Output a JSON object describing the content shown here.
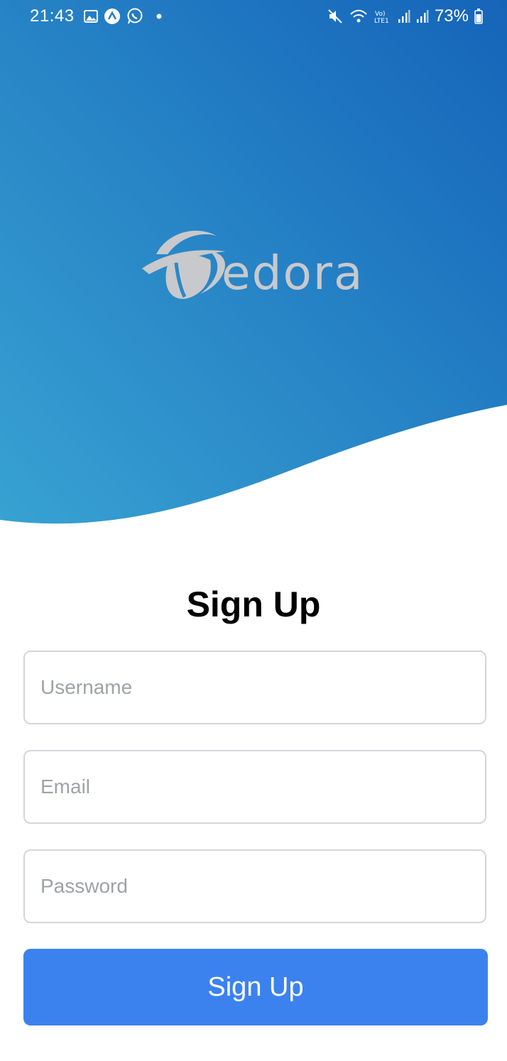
{
  "status_bar": {
    "time": "21:43",
    "battery": "73%",
    "left_icons": [
      "gallery-icon",
      "app-icon",
      "whatsapp-icon",
      "dot-icon"
    ],
    "right_icons": [
      "mute-icon",
      "wifi-icon",
      "volte-icon",
      "signal-icon",
      "signal-icon",
      "battery-icon"
    ]
  },
  "hero": {
    "logo_text": "edora",
    "gradient_colors": [
      "#3aa3d3",
      "#1a67bb"
    ]
  },
  "form": {
    "title": "Sign Up",
    "username_placeholder": "Username",
    "email_placeholder": "Email",
    "password_placeholder": "Password",
    "submit_label": "Sign Up",
    "accent_color": "#3b82ef"
  }
}
